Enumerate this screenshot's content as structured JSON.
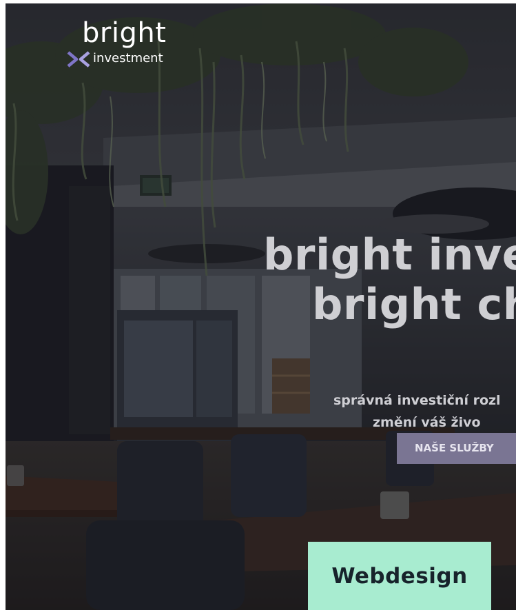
{
  "brand": {
    "wordmark": "bright",
    "sub": "investment",
    "mark_colors": [
      "#7f75c7",
      "#a9a1e0"
    ]
  },
  "hero": {
    "headline_1": "bright inves",
    "headline_2": "bright cho",
    "subline_1": "správná investiční rozl",
    "subline_2": "změní váš živo"
  },
  "cta": {
    "label": "NAŠE SLUŽBY"
  },
  "tag": {
    "label": "Webdesign"
  },
  "colors": {
    "accent": "#7a7593",
    "tag_bg": "#a8ecd0",
    "tag_text": "#17232b"
  }
}
